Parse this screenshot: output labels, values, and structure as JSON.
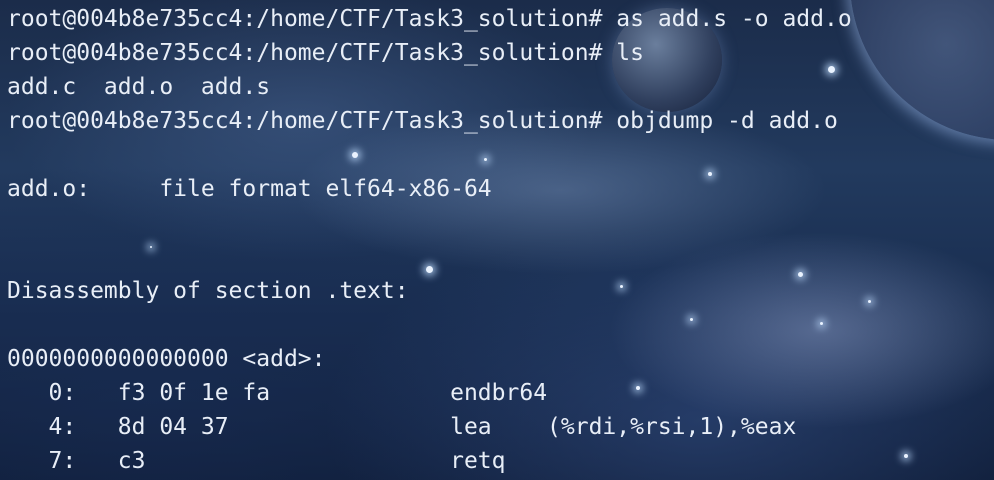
{
  "terminal": {
    "lines": [
      "root@004b8e735cc4:/home/CTF/Task3_solution# as add.s -o add.o",
      "root@004b8e735cc4:/home/CTF/Task3_solution# ls",
      "add.c  add.o  add.s",
      "root@004b8e735cc4:/home/CTF/Task3_solution# objdump -d add.o",
      "",
      "add.o:     file format elf64-x86-64",
      "",
      "",
      "Disassembly of section .text:",
      "",
      "0000000000000000 <add>:",
      "   0:\tf3 0f 1e fa          \tendbr64",
      "   4:\t8d 04 37             \tlea    (%rdi,%rsi,1),%eax",
      "   7:\tc3                   \tretq"
    ]
  },
  "background": {
    "theme": "space-nebula",
    "colors": {
      "text": "#e8eef7",
      "base": "#1b2c4a"
    }
  }
}
